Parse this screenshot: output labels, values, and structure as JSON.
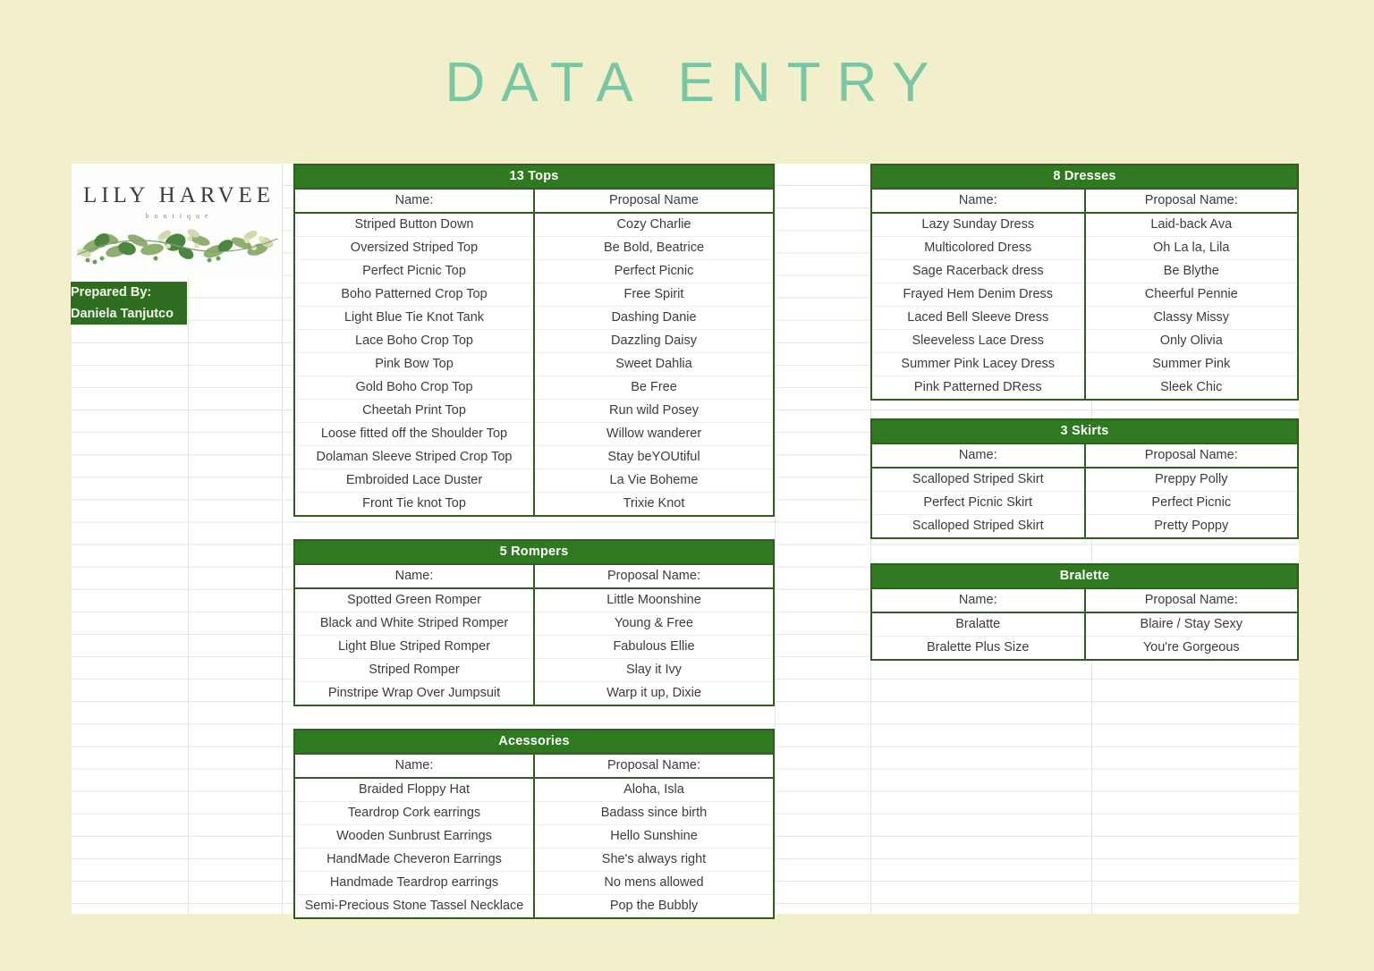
{
  "page": {
    "title": "DATA ENTRY",
    "title_color": "#79c6a4",
    "background_color": "#f2f0ca",
    "header_band_color": "#2f7a20",
    "table_border_color": "#2f5d22"
  },
  "logo": {
    "name": "LILY HARVEE",
    "subtitle": "boutique"
  },
  "prepared_by": {
    "label": "Prepared By:",
    "value": "Daniela Tanjutco"
  },
  "tables": {
    "tops": {
      "band": "13 Tops",
      "columns": [
        "Name:",
        "Proposal Name"
      ],
      "rows": [
        [
          "Striped Button Down",
          "Cozy Charlie"
        ],
        [
          "Oversized Striped Top",
          "Be Bold, Beatrice"
        ],
        [
          "Perfect Picnic Top",
          "Perfect Picnic"
        ],
        [
          "Boho Patterned Crop Top",
          "Free Spirit"
        ],
        [
          "Light Blue Tie Knot Tank",
          "Dashing Danie"
        ],
        [
          "Lace Boho Crop Top",
          "Dazzling Daisy"
        ],
        [
          "Pink Bow Top",
          "Sweet Dahlia"
        ],
        [
          "Gold Boho Crop Top",
          "Be Free"
        ],
        [
          "Cheetah Print Top",
          "Run wild Posey"
        ],
        [
          "Loose fitted off the Shoulder Top",
          "Willow wanderer"
        ],
        [
          "Dolaman Sleeve Striped Crop Top",
          "Stay beYOUtiful"
        ],
        [
          "Embroided Lace Duster",
          "La Vie Boheme"
        ],
        [
          "Front Tie knot Top",
          "Trixie Knot"
        ]
      ]
    },
    "rompers": {
      "band": "5 Rompers",
      "columns": [
        "Name:",
        "Proposal Name:"
      ],
      "rows": [
        [
          "Spotted Green Romper",
          "Little Moonshine"
        ],
        [
          "Black and White Striped Romper",
          "Young & Free"
        ],
        [
          "Light Blue Striped Romper",
          "Fabulous Ellie"
        ],
        [
          "Striped Romper",
          "Slay it Ivy"
        ],
        [
          "Pinstripe Wrap Over Jumpsuit",
          "Warp it up, Dixie"
        ]
      ]
    },
    "accessories": {
      "band": "Acessories",
      "columns": [
        "Name:",
        "Proposal Name:"
      ],
      "rows": [
        [
          "Braided Floppy Hat",
          "Aloha, Isla"
        ],
        [
          "Teardrop Cork earrings",
          "Badass since birth"
        ],
        [
          "Wooden Sunbrust Earrings",
          "Hello Sunshine"
        ],
        [
          "HandMade  Cheveron Earrings",
          "She's always right"
        ],
        [
          "Handmade Teardrop earrings",
          "No mens allowed"
        ],
        [
          "Semi-Precious Stone Tassel Necklace",
          "Pop the Bubbly"
        ]
      ]
    },
    "dresses": {
      "band": "8 Dresses",
      "columns": [
        "Name:",
        "Proposal Name:"
      ],
      "rows": [
        [
          "Lazy Sunday Dress",
          "Laid-back Ava"
        ],
        [
          "Multicolored Dress",
          "Oh La la, Lila"
        ],
        [
          "Sage Racerback dress",
          "Be Blythe"
        ],
        [
          "Frayed Hem Denim Dress",
          "Cheerful Pennie"
        ],
        [
          "Laced Bell Sleeve Dress",
          "Classy Missy"
        ],
        [
          "Sleeveless Lace Dress",
          "Only Olivia"
        ],
        [
          "Summer Pink Lacey Dress",
          "Summer Pink"
        ],
        [
          "Pink Patterned DRess",
          "Sleek Chic"
        ]
      ]
    },
    "skirts": {
      "band": "3 Skirts",
      "columns": [
        "Name:",
        "Proposal Name:"
      ],
      "rows": [
        [
          "Scalloped Striped Skirt",
          "Preppy  Polly"
        ],
        [
          "Perfect Picnic Skirt",
          "Perfect Picnic"
        ],
        [
          "Scalloped Striped Skirt",
          "Pretty Poppy"
        ]
      ]
    },
    "bralette": {
      "band": "Bralette",
      "columns": [
        "Name:",
        "Proposal Name:"
      ],
      "rows": [
        [
          "Bralatte",
          "Blaire / Stay Sexy"
        ],
        [
          "Bralette Plus Size",
          "You're Gorgeous"
        ]
      ]
    }
  }
}
